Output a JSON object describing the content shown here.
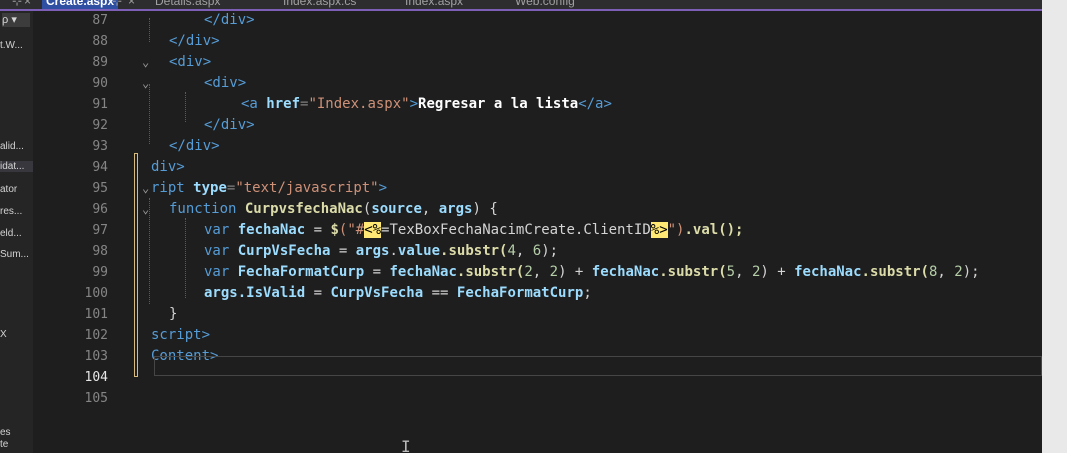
{
  "tabs": [
    {
      "label": "Create.aspx",
      "active": true
    },
    {
      "label": "Details.aspx",
      "active": false
    },
    {
      "label": "Index.aspx.cs",
      "active": false
    },
    {
      "label": "Index.aspx",
      "active": false
    },
    {
      "label": "Web.config",
      "active": false
    }
  ],
  "tab_controls": {
    "pin": "⊹",
    "close": "×"
  },
  "explorer": {
    "search": "ρ ▾",
    "items": [
      "t.W...",
      "alid...",
      "idat...",
      "ator",
      "res...",
      "eld...",
      "Sum...",
      "X",
      "es",
      "te"
    ]
  },
  "line_numbers": [
    "87",
    "88",
    "89",
    "90",
    "91",
    "92",
    "93",
    "94",
    "95",
    "96",
    "97",
    "98",
    "99",
    "100",
    "101",
    "102",
    "103",
    "104",
    "105"
  ],
  "current_line": "104",
  "code": {
    "l87": "</div>",
    "l88": "</div>",
    "l89": "<div>",
    "l90": "<div>",
    "l91_open": "<a ",
    "l91_attr": "href",
    "l91_eq": "=",
    "l91_val": "\"Index.aspx\"",
    "l91_close_open": ">",
    "l91_text": "Regresar a la lista",
    "l91_end": "</a>",
    "l92": "</div>",
    "l93": "</div>",
    "l94": "div>",
    "l95_tag": "ript ",
    "l95_attr": "type",
    "l95_val": "\"text/javascript\"",
    "l95_end": ">",
    "l96_kw": "function ",
    "l96_fn": "CurpvsfechaNac",
    "l96_p1": "(",
    "l96_a1": "source",
    "l96_sep": ", ",
    "l96_a2": "args",
    "l96_p2": ") {",
    "l97_kw": "var ",
    "l97_var": "fechaNac",
    "l97_eq": " = ",
    "l97_fn": "$",
    "l97_str1": "(\"#",
    "l97_d1": "<%",
    "l97_asp": "=TexBoxFechaNacimCreate.ClientID",
    "l97_d2": "%>",
    "l97_str2": "\")",
    "l97_end": ".val();",
    "l98_kw": "var ",
    "l98_var": "CurpVsFecha",
    "l98_eq": " = ",
    "l98_obj": "args",
    "l98_dot": ".",
    "l98_prop": "value",
    "l98_meth": ".substr(",
    "l98_n1": "4",
    "l98_c": ", ",
    "l98_n2": "6",
    "l98_end": ");",
    "l99_kw": "var ",
    "l99_var": "FechaFormatCurp",
    "l99_eq": " = ",
    "l99_a": "fechaNac",
    "l99_m1": ".substr(",
    "l99_n1": "2",
    "l99_c1": ", ",
    "l99_n2": "2",
    "l99_p1": ") + ",
    "l99_b": "fechaNac",
    "l99_m2": ".substr(",
    "l99_n3": "5",
    "l99_c2": ", ",
    "l99_n4": "2",
    "l99_p2": ") + ",
    "l99_c": "fechaNac",
    "l99_m3": ".substr(",
    "l99_n5": "8",
    "l99_c3": ", ",
    "l99_n6": "2",
    "l99_end": ");",
    "l100_obj": "args",
    "l100_prop": ".IsValid",
    "l100_eq": " = ",
    "l100_a": "CurpVsFecha",
    "l100_op": " == ",
    "l100_b": "FechaFormatCurp",
    "l100_end": ";",
    "l101": "}",
    "l102": "script>",
    "l103": "Content>"
  },
  "colors": {
    "background": "#1e1e1e",
    "tag": "#569cd6",
    "attribute": "#9cdcfe",
    "string": "#ce9178",
    "function": "#dcdcaa",
    "number": "#b5cea8",
    "asp_delimiter_highlight": "#ffe873",
    "change_indicator": "#d7ba7d",
    "tab_active": "#2f4fa3",
    "tab_border": "#7d5fb8"
  },
  "icons": [
    "pin-icon",
    "close-icon",
    "search-icon",
    "fold-chevron-icon",
    "text-cursor-icon"
  ]
}
